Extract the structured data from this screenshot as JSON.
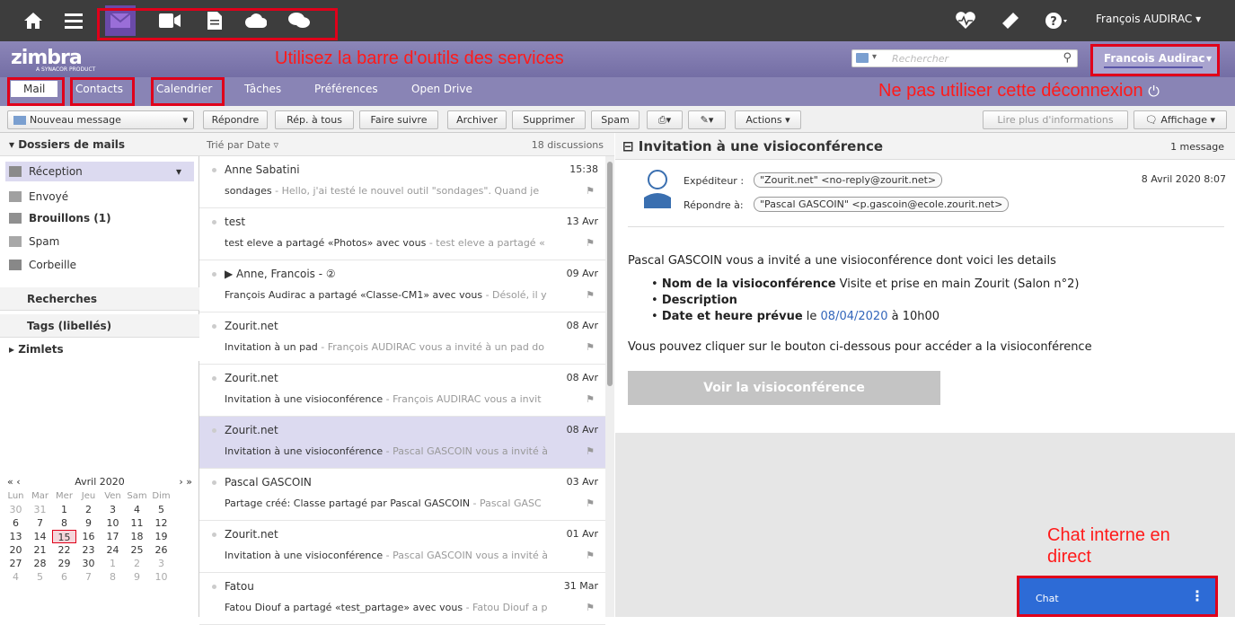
{
  "user": {
    "name": "François AUDIRAC",
    "header_name": "Francois Audirac"
  },
  "logo": {
    "text": "zimbra",
    "sub": "A SYNACOR PRODUCT"
  },
  "annotations": {
    "services": "Utilisez la barre d'outils des services",
    "logout": "Ne pas utiliser cette déconnexion",
    "chat": "Chat interne en direct"
  },
  "search": {
    "placeholder": "Rechercher"
  },
  "tabs": [
    "Mail",
    "Contacts",
    "Calendrier",
    "Tâches",
    "Préférences",
    "Open Drive"
  ],
  "toolbar": {
    "new_message": "Nouveau message",
    "reply": "Répondre",
    "reply_all": "Rép. à tous",
    "forward": "Faire suivre",
    "archive": "Archiver",
    "delete": "Supprimer",
    "spam": "Spam",
    "actions": "Actions",
    "read_more": "Lire plus d'informations",
    "view": "Affichage"
  },
  "folders": {
    "header": "Dossiers de mails",
    "items": [
      "Réception",
      "Envoyé",
      "Brouillons (1)",
      "Spam",
      "Corbeille"
    ],
    "searches": "Recherches",
    "tags": "Tags (libellés)",
    "zimlets": "Zimlets"
  },
  "calendar": {
    "month": "Avril 2020",
    "days": [
      "Lun",
      "Mar",
      "Mer",
      "Jeu",
      "Ven",
      "Sam",
      "Dim"
    ],
    "weeks": [
      [
        "30",
        "31",
        "1",
        "2",
        "3",
        "4",
        "5"
      ],
      [
        "6",
        "7",
        "8",
        "9",
        "10",
        "11",
        "12"
      ],
      [
        "13",
        "14",
        "15",
        "16",
        "17",
        "18",
        "19"
      ],
      [
        "20",
        "21",
        "22",
        "23",
        "24",
        "25",
        "26"
      ],
      [
        "27",
        "28",
        "29",
        "30",
        "1",
        "2",
        "3"
      ],
      [
        "4",
        "5",
        "6",
        "7",
        "8",
        "9",
        "10"
      ]
    ],
    "today": "15"
  },
  "list": {
    "sort": "Trié par Date",
    "count": "18 discussions",
    "messages": [
      {
        "from": "Anne Sabatini",
        "date": "15:38",
        "subject": "sondages",
        "fragment": " - Hello, j'ai testé le nouvel outil \"sondages\". Quand je"
      },
      {
        "from": "test",
        "date": "13 Avr",
        "subject": "test eleve a partagé «Photos» avec vous",
        "fragment": " - test eleve a partagé «"
      },
      {
        "from": "▶ Anne, Francois - ②",
        "date": "09 Avr",
        "subject": "François Audirac a partagé «Classe-CM1» avec vous",
        "fragment": " - Désolé, il y"
      },
      {
        "from": "Zourit.net",
        "date": "08 Avr",
        "subject": "Invitation à un pad",
        "fragment": " - François AUDIRAC vous a invité à un pad do"
      },
      {
        "from": "Zourit.net",
        "date": "08 Avr",
        "subject": "Invitation à une visioconférence",
        "fragment": " - François AUDIRAC vous a invit"
      },
      {
        "from": "Zourit.net",
        "date": "08 Avr",
        "subject": "Invitation à une visioconférence",
        "fragment": " - Pascal GASCOIN vous a invité à"
      },
      {
        "from": "Pascal GASCOIN",
        "date": "03 Avr",
        "subject": "Partage créé: Classe partagé par Pascal GASCOIN",
        "fragment": " - Pascal GASC"
      },
      {
        "from": "Zourit.net",
        "date": "01 Avr",
        "subject": "Invitation à une visioconférence",
        "fragment": " - Pascal GASCOIN vous a invité à"
      },
      {
        "from": "Fatou",
        "date": "31 Mar",
        "subject": "Fatou Diouf a partagé «test_partage» avec vous",
        "fragment": " - Fatou Diouf a p"
      }
    ]
  },
  "reading": {
    "title": "Invitation à une visioconférence",
    "count": "1 message",
    "sender_label": "Expéditeur :",
    "sender": "\"Zourit.net\" <no-reply@zourit.net>",
    "replyto_label": "Répondre à:",
    "replyto": "\"Pascal GASCOIN\" <p.gascoin@ecole.zourit.net>",
    "date": "8 Avril 2020 8:07",
    "intro": "Pascal GASCOIN vous a invité a une visioconférence dont voici les details",
    "b1_label": "Nom de la visioconférence",
    "b1_value": " Visite et prise en main Zourit (Salon n°2)",
    "b2_label": "Description",
    "b3_label": "Date et heure prévue",
    "b3_mid": " le ",
    "b3_date": "08/04/2020",
    "b3_end": " à 10h00",
    "outro": "Vous pouvez cliquer sur le bouton ci-dessous pour accéder a la visioconférence",
    "button": "Voir la visioconférence"
  },
  "chat": {
    "label": "Chat"
  }
}
